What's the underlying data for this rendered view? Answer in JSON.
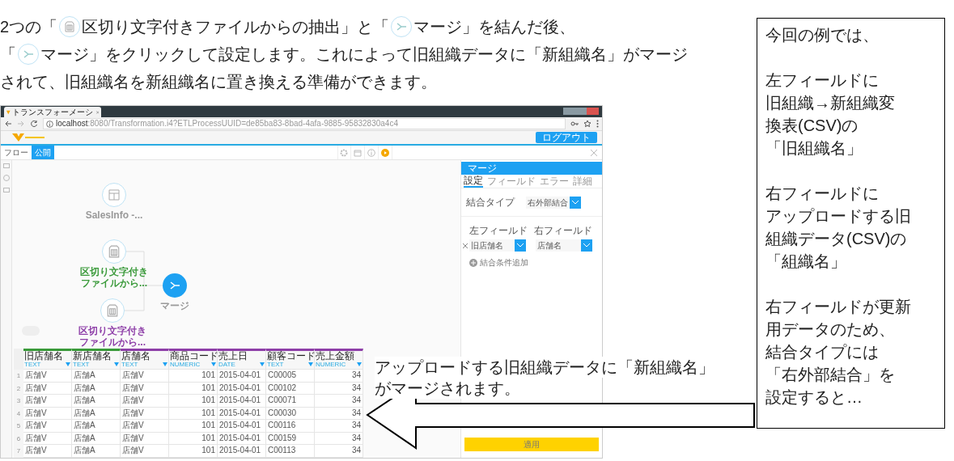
{
  "intro": [
    [
      {
        "kind": "text",
        "text": "2つの「"
      },
      {
        "kind": "file-icon"
      },
      {
        "kind": "text",
        "text": "区切り文字付きファイルからの抽出」と「"
      },
      {
        "kind": "merge-icon"
      },
      {
        "kind": "text",
        "text": "マージ」を結んだ後、"
      }
    ],
    [
      {
        "kind": "text",
        "text": "「"
      },
      {
        "kind": "merge-icon"
      },
      {
        "kind": "text",
        "text": "マージ」をクリックして設定します。これによって旧組織データに「新組織名」がマージ"
      }
    ],
    [
      {
        "kind": "text",
        "text": "されて、旧組織名を新組織名に置き換える準備ができます。"
      }
    ]
  ],
  "browser": {
    "tab_title": "トランスフォーメーシ",
    "url_host": "localhost",
    "url_path": ":8080/Transformation.i4?ETLProcessUUID=de85ba83-8bad-4afa-9885-95832830a4c4"
  },
  "app": {
    "logout": "ログアウト",
    "tabs": [
      {
        "label": "フロー",
        "selected": false
      },
      {
        "label": "公開",
        "selected": true
      }
    ]
  },
  "canvas": {
    "nodes": [
      {
        "kind": "table",
        "label": [
          "SalesInfo -..."
        ],
        "color": "#9a9a9a"
      },
      {
        "kind": "file",
        "label": [
          "区切り文字付き",
          "ファイルから..."
        ],
        "color": "#3a9a3a"
      },
      {
        "kind": "file",
        "label": [
          "区切り文字付き",
          "ファイルから..."
        ],
        "color": "#8e3fa8"
      },
      {
        "kind": "merge",
        "label": [
          "マージ"
        ],
        "color": "#9a9a9a"
      }
    ]
  },
  "table": {
    "columns": [
      {
        "name": "旧店舗名",
        "type": "TEXT",
        "color": "#3a9a3a"
      },
      {
        "name": "新店舗名",
        "type": "TEXT",
        "color": "#3a9a3a"
      },
      {
        "name": "店舗名",
        "type": "TEXT",
        "color": "#8e3fa8"
      },
      {
        "name": "商品コード",
        "type": "NUMERIC",
        "color": "#8e3fa8"
      },
      {
        "name": "売上日",
        "type": "DATE",
        "color": "#8e3fa8"
      },
      {
        "name": "顧客コード",
        "type": "TEXT",
        "color": "#8e3fa8"
      },
      {
        "name": "売上金額",
        "type": "NUMERIC",
        "color": "#8e3fa8"
      }
    ],
    "rows": [
      {
        "num": "1",
        "cells": [
          "店舗V",
          "店舗A",
          "店舗V",
          "101",
          "2015-04-01",
          "C00005",
          "34"
        ]
      },
      {
        "num": "2",
        "cells": [
          "店舗V",
          "店舗A",
          "店舗V",
          "101",
          "2015-04-01",
          "C00102",
          "34"
        ]
      },
      {
        "num": "3",
        "cells": [
          "店舗V",
          "店舗A",
          "店舗V",
          "101",
          "2015-04-01",
          "C00071",
          "34"
        ]
      },
      {
        "num": "4",
        "cells": [
          "店舗V",
          "店舗A",
          "店舗V",
          "101",
          "2015-04-01",
          "C00030",
          "34"
        ]
      },
      {
        "num": "5",
        "cells": [
          "店舗V",
          "店舗A",
          "店舗V",
          "101",
          "2015-04-01",
          "C00116",
          "34"
        ]
      },
      {
        "num": "6",
        "cells": [
          "店舗V",
          "店舗A",
          "店舗V",
          "101",
          "2015-04-01",
          "C00159",
          "34"
        ]
      },
      {
        "num": "7",
        "cells": [
          "店舗V",
          "店舗A",
          "店舗V",
          "101",
          "2015-04-01",
          "C00113",
          "34"
        ]
      }
    ]
  },
  "panel": {
    "title": "マージ",
    "tabs": [
      {
        "label": "設定",
        "selected": true
      },
      {
        "label": "フィールド",
        "selected": false
      },
      {
        "label": "エラー",
        "selected": false
      },
      {
        "label": "詳細",
        "selected": false
      }
    ],
    "join_type_label": "結合タイプ",
    "join_type": "右外部結合",
    "left_label": "左フィールド",
    "right_label": "右フィールド",
    "left_value": "旧店舗名",
    "right_value": "店舗名",
    "add_condition": "結合条件追加",
    "apply": "適用"
  },
  "callout": [
    "アップロードする旧組織データに「新組織名」",
    "がマージされます。"
  ],
  "note": [
    [
      "今回の例では、"
    ],
    [
      "左フィールドに",
      "旧組織→新組織変",
      "換表(CSV)の",
      "「旧組織名」"
    ],
    [
      "右フィールドに",
      "アップロードする旧",
      "組織データ(CSV)の",
      "「組織名」"
    ],
    [
      "右フィールドが更新",
      "用データのため、",
      "結合タイプには",
      "「右外部結合」を",
      "設定すると…"
    ]
  ]
}
